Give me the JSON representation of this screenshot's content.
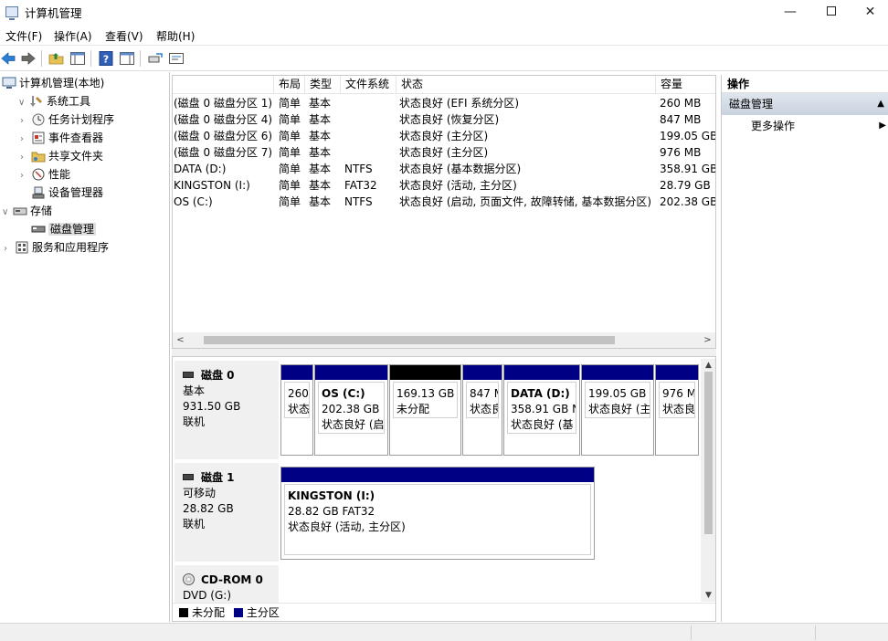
{
  "window": {
    "title": "计算机管理",
    "minimize": "—",
    "close": "✕"
  },
  "menu": [
    "文件(F)",
    "操作(A)",
    "查看(V)",
    "帮助(H)"
  ],
  "tree": {
    "root": "计算机管理(本地)",
    "system_tools": "系统工具",
    "task_scheduler": "任务计划程序",
    "event_viewer": "事件查看器",
    "shared_folders": "共享文件夹",
    "performance": "性能",
    "device_manager": "设备管理器",
    "storage": "存储",
    "disk_management": "磁盘管理",
    "services_apps": "服务和应用程序"
  },
  "volumes": {
    "columns": [
      "",
      "布局",
      "类型",
      "文件系统",
      "状态",
      "容量"
    ],
    "rows": [
      [
        "(磁盘 0 磁盘分区 1)",
        "简单",
        "基本",
        "",
        "状态良好 (EFI 系统分区)",
        "260 MB"
      ],
      [
        "(磁盘 0 磁盘分区 4)",
        "简单",
        "基本",
        "",
        "状态良好 (恢复分区)",
        "847 MB"
      ],
      [
        "(磁盘 0 磁盘分区 6)",
        "简单",
        "基本",
        "",
        "状态良好 (主分区)",
        "199.05 GB"
      ],
      [
        "(磁盘 0 磁盘分区 7)",
        "简单",
        "基本",
        "",
        "状态良好 (主分区)",
        "976 MB"
      ],
      [
        "DATA (D:)",
        "简单",
        "基本",
        "NTFS",
        "状态良好 (基本数据分区)",
        "358.91 GB"
      ],
      [
        "KINGSTON (I:)",
        "简单",
        "基本",
        "FAT32",
        "状态良好 (活动, 主分区)",
        "28.79 GB"
      ],
      [
        "OS (C:)",
        "简单",
        "基本",
        "NTFS",
        "状态良好 (启动, 页面文件, 故障转储, 基本数据分区)",
        "202.38 GB"
      ]
    ],
    "scroll_left": "<",
    "scroll_right": ">"
  },
  "disks": {
    "disk0": {
      "name": "磁盘 0",
      "type": "基本",
      "size": "931.50 GB",
      "state": "联机",
      "partitions": [
        {
          "name": "",
          "line1": "260",
          "line2": "状态"
        },
        {
          "name": "OS  (C:)",
          "line1": "202.38 GB I",
          "line2": "状态良好 (启"
        },
        {
          "name": "",
          "line1": "169.13 GB",
          "line2": "未分配"
        },
        {
          "name": "",
          "line1": "847 M",
          "line2": "状态良"
        },
        {
          "name": "DATA  (D:)",
          "line1": "358.91 GB N",
          "line2": "状态良好 (基"
        },
        {
          "name": "",
          "line1": "199.05 GB",
          "line2": "状态良好 (主"
        },
        {
          "name": "",
          "line1": "976 M",
          "line2": "状态良"
        }
      ]
    },
    "disk1": {
      "name": "磁盘 1",
      "type": "可移动",
      "size": "28.82 GB",
      "state": "联机",
      "partition": {
        "name": "KINGSTON  (I:)",
        "line1": "28.82 GB FAT32",
        "line2": "状态良好 (活动, 主分区)"
      }
    },
    "cdrom0": {
      "name": "CD-ROM 0",
      "type": "DVD (G:)"
    },
    "legend": {
      "unallocated": "未分配",
      "primary": "主分区",
      "unallocated_color": "#000000",
      "primary_color": "#000084"
    }
  },
  "actions": {
    "header": "操作",
    "section": "磁盘管理",
    "more": "更多操作"
  }
}
